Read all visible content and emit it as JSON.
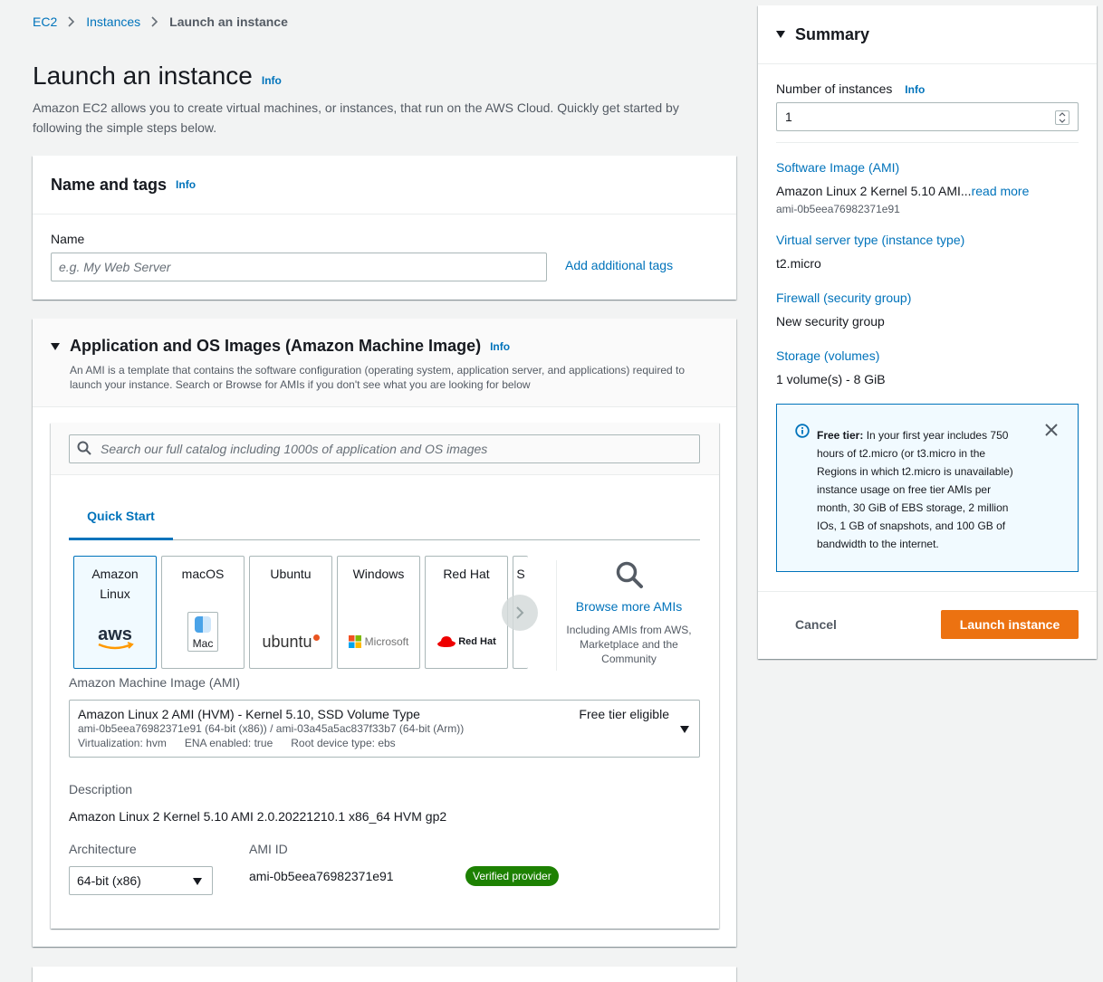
{
  "breadcrumb": {
    "items": [
      "EC2",
      "Instances"
    ],
    "current": "Launch an instance"
  },
  "page": {
    "title": "Launch an instance",
    "info": "Info",
    "description": "Amazon EC2 allows you to create virtual machines, or instances, that run on the AWS Cloud. Quickly get started by following the simple steps below."
  },
  "name_tags": {
    "title": "Name and tags",
    "info": "Info",
    "name_label": "Name",
    "name_placeholder": "e.g. My Web Server",
    "add_tags": "Add additional tags"
  },
  "ami": {
    "title": "Application and OS Images (Amazon Machine Image)",
    "info": "Info",
    "description": "An AMI is a template that contains the software configuration (operating system, application server, and applications) required to launch your instance. Search or Browse for AMIs if you don't see what you are looking for below",
    "search_placeholder": "Search our full catalog including 1000s of application and OS images",
    "tab": "Quick Start",
    "os_tiles": [
      {
        "label": "Amazon Linux",
        "logo": "aws"
      },
      {
        "label": "macOS",
        "logo": "Mac"
      },
      {
        "label": "Ubuntu",
        "logo": "ubuntu"
      },
      {
        "label": "Windows",
        "logo": "Microsoft"
      },
      {
        "label": "Red Hat",
        "logo": "Red Hat"
      },
      {
        "label": "S",
        "logo": ""
      }
    ],
    "browse_more": "Browse more AMIs",
    "browse_sub": "Including AMIs from AWS, Marketplace and the Community",
    "ami_label": "Amazon Machine Image (AMI)",
    "selected_name": "Amazon Linux 2 AMI (HVM) - Kernel 5.10, SSD Volume Type",
    "selected_ids": "ami-0b5eea76982371e91 (64-bit (x86)) / ami-03a45a5ac837f33b7 (64-bit (Arm))",
    "selected_virt": "Virtualization: hvm",
    "selected_ena": "ENA enabled: true",
    "selected_root": "Root device type: ebs",
    "free_tier": "Free tier eligible",
    "description_label": "Description",
    "description_value": "Amazon Linux 2 Kernel 5.10 AMI 2.0.20221210.1 x86_64 HVM gp2",
    "arch_label": "Architecture",
    "arch_value": "64-bit (x86)",
    "ami_id_label": "AMI ID",
    "ami_id_value": "ami-0b5eea76982371e91",
    "verified": "Verified provider"
  },
  "summary": {
    "title": "Summary",
    "num_label": "Number of instances",
    "info": "Info",
    "num_value": "1",
    "software_label": "Software Image (AMI)",
    "software_value": "Amazon Linux 2 Kernel 5.10 AMI...",
    "read_more": "read more",
    "software_id": "ami-0b5eea76982371e91",
    "server_label": "Virtual server type (instance type)",
    "server_value": "t2.micro",
    "firewall_label": "Firewall (security group)",
    "firewall_value": "New security group",
    "storage_label": "Storage (volumes)",
    "storage_value": "1 volume(s) - 8 GiB",
    "free_tier_bold": "Free tier:",
    "free_tier_text": " In your first year includes 750 hours of t2.micro (or t3.micro in the Regions in which t2.micro is unavailable) instance usage on free tier AMIs per month, 30 GiB of EBS storage, 2 million IOs, 1 GB of snapshots, and 100 GB of bandwidth to the internet.",
    "cancel": "Cancel",
    "launch": "Launch instance"
  },
  "colors": {
    "accent": "#0073bb",
    "launch": "#ec7211",
    "verified": "#1d8102"
  }
}
